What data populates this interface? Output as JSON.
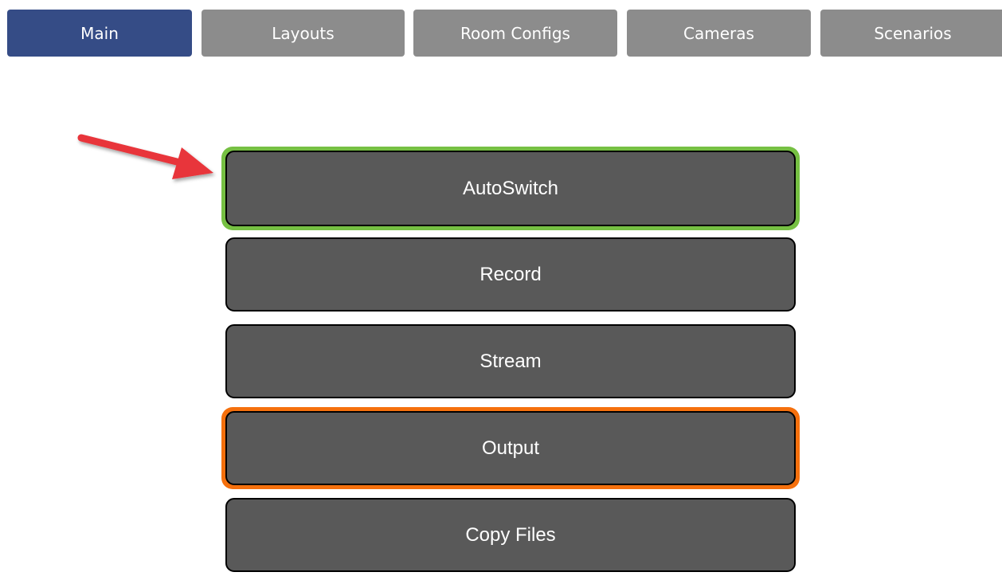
{
  "tabs": [
    {
      "label": "Main",
      "active": true
    },
    {
      "label": "Layouts",
      "active": false
    },
    {
      "label": "Room Configs",
      "active": false
    },
    {
      "label": "Cameras",
      "active": false
    },
    {
      "label": "Scenarios",
      "active": false
    }
  ],
  "controls": [
    {
      "label": "AutoSwitch",
      "highlight": "green"
    },
    {
      "label": "Record",
      "highlight": "none"
    },
    {
      "label": "Stream",
      "highlight": "none"
    },
    {
      "label": "Output",
      "highlight": "orange"
    },
    {
      "label": "Copy Files",
      "highlight": "none"
    }
  ],
  "colors": {
    "tab_active": "#354c86",
    "tab_inactive": "#8c8c8c",
    "button_fill": "#595959",
    "highlight_green": "#76c043",
    "highlight_orange": "#f5700d",
    "annotation_arrow": "#e8363a"
  },
  "annotation": {
    "type": "arrow",
    "points_to": "autoswitch-button"
  }
}
